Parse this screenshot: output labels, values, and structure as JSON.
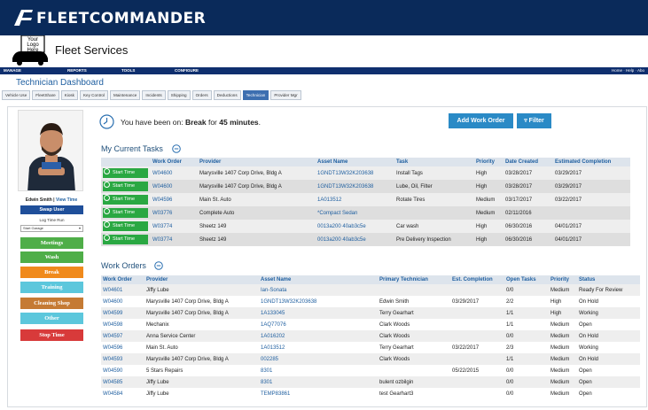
{
  "brand": {
    "name": "FLEETCOMMANDER"
  },
  "app": {
    "logo_text": "Your Logo Here",
    "title": "Fleet Services"
  },
  "navbar": {
    "items": [
      "MANAGE",
      "REPORTS",
      "TOOLS",
      "CONFIGURE"
    ],
    "right_links": "Home · Help · Abo"
  },
  "page_title": "Technician Dashboard",
  "tabs": [
    "Vehicle Use",
    "FleetShare",
    "Kiosk",
    "Key Control",
    "Maintenance",
    "Incidents",
    "Shipping",
    "Orders",
    "Deductions",
    "Technician",
    "Provider Mgr"
  ],
  "active_tab": "Technician",
  "sidebar": {
    "user_name": "Edwin Smith",
    "view_time": "View Time",
    "separator": "|",
    "swap_user": "Swap User",
    "log_time_label": "Log Time Run",
    "log_time_value": "Start Garage",
    "buttons": [
      {
        "label": "Meetings",
        "color": "#4fae48"
      },
      {
        "label": "Wash",
        "color": "#4fae48"
      },
      {
        "label": "Break",
        "color": "#f08a1c"
      },
      {
        "label": "Training",
        "color": "#5cc7dc"
      },
      {
        "label": "Cleaning Shop",
        "color": "#c57a34"
      },
      {
        "label": "Other",
        "color": "#5cc7dc"
      },
      {
        "label": "Stop Time",
        "color": "#d83a3a"
      }
    ]
  },
  "break_notice": {
    "prefix": "You have been on: ",
    "status": "Break",
    "middle": " for ",
    "duration": "45 minutes",
    "suffix": "."
  },
  "actions": {
    "add_work_order": "Add Work Order",
    "filter": "Filter"
  },
  "current_tasks": {
    "title": "My Current Tasks",
    "start_label": "Start Time",
    "columns": [
      "",
      "Work Order",
      "Provider",
      "Asset Name",
      "Task",
      "Priority",
      "Date Created",
      "Estimated Completion"
    ],
    "rows": [
      [
        "W04600",
        "Marysville 1407 Corp Drive, Bldg A",
        "1GNDT13W32K203638",
        "Install Tags",
        "High",
        "03/28/2017",
        "03/29/2017"
      ],
      [
        "W04600",
        "Marysville 1407 Corp Drive, Bldg A",
        "1GNDT13W32K203638",
        "Lube, Oil, Filter",
        "High",
        "03/28/2017",
        "03/29/2017"
      ],
      [
        "W04596",
        "Main St. Auto",
        "1A013512",
        "Rotate Tires",
        "Medium",
        "03/17/2017",
        "03/22/2017"
      ],
      [
        "W03776",
        "Complete Auto",
        "*Compact Sedan",
        "",
        "Medium",
        "02/11/2016",
        ""
      ],
      [
        "W03774",
        "Sheetz 149",
        "0013a200 40ab3c5e",
        "Car wash",
        "High",
        "06/30/2016",
        "04/01/2017"
      ],
      [
        "W03774",
        "Sheetz 149",
        "0013a200 40ab3c5e",
        "Pre Delivery Inspection",
        "High",
        "06/30/2016",
        "04/01/2017"
      ]
    ]
  },
  "work_orders": {
    "title": "Work Orders",
    "columns": [
      "Work Order",
      "Provider",
      "Asset Name",
      "Primary Technician",
      "Est. Completion",
      "Open Tasks",
      "Priority",
      "Status"
    ],
    "rows": [
      [
        "W04601",
        "Jiffy Lube",
        "Ian-Sonata",
        "",
        "",
        "0/0",
        "Medium",
        "Ready For Review"
      ],
      [
        "W04600",
        "Marysville 1407 Corp Drive, Bldg A",
        "1GNDT13W32K203638",
        "Edwin Smith",
        "03/29/2017",
        "2/2",
        "High",
        "On Hold"
      ],
      [
        "W04599",
        "Marysville 1407 Corp Drive, Bldg A",
        "1A133045",
        "Terry Gearhart",
        "",
        "1/1",
        "High",
        "Working"
      ],
      [
        "W04598",
        "Mechanix",
        "1AQ77076",
        "Clark Woods",
        "",
        "1/1",
        "Medium",
        "Open"
      ],
      [
        "W04597",
        "Anna Service Center",
        "1A016202",
        "Clark Woods",
        "",
        "0/0",
        "Medium",
        "On Hold"
      ],
      [
        "W04596",
        "Main St. Auto",
        "1A013512",
        "Terry Gearhart",
        "03/22/2017",
        "2/3",
        "Medium",
        "Working"
      ],
      [
        "W04593",
        "Marysville 1407 Corp Drive, Bldg A",
        "002285",
        "Clark Woods",
        "",
        "1/1",
        "Medium",
        "On Hold"
      ],
      [
        "W04590",
        "5 Stars Repairs",
        "8301",
        "",
        "05/22/2015",
        "0/0",
        "Medium",
        "Open"
      ],
      [
        "W04585",
        "Jiffy Lube",
        "8301",
        "bulent ozbilgin",
        "",
        "0/0",
        "Medium",
        "Open"
      ],
      [
        "W04584",
        "Jiffy Lube",
        "TEMP83861",
        "test Gearhart3",
        "",
        "0/0",
        "Medium",
        "Open"
      ]
    ]
  }
}
